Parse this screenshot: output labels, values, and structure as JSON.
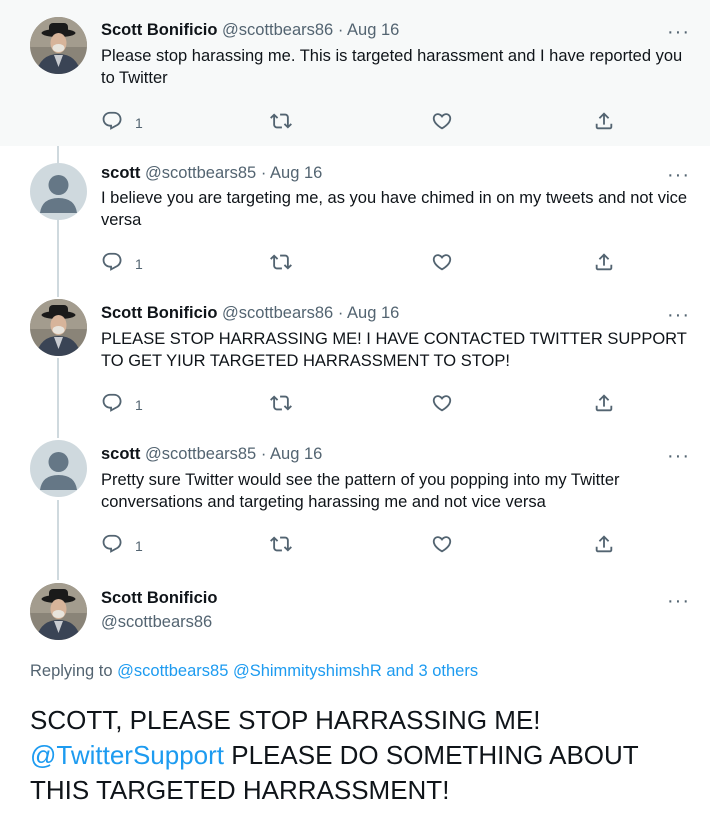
{
  "tweets": [
    {
      "name": "Scott Bonificio",
      "handle": "@scottbears86",
      "sep": "·",
      "date": "Aug 16",
      "text": "Please stop harassing me. This is targeted harassment and I have reported you to Twitter",
      "reply_count": "1",
      "avatar": "photo"
    },
    {
      "name": "scott",
      "handle": "@scottbears85",
      "sep": "·",
      "date": "Aug 16",
      "text": "I believe you are targeting me, as you have chimed in on my tweets and not vice versa",
      "reply_count": "1",
      "avatar": "default"
    },
    {
      "name": "Scott Bonificio",
      "handle": "@scottbears86",
      "sep": "·",
      "date": "Aug 16",
      "text": "PLEASE STOP HARRASSING ME! I HAVE CONTACTED TWITTER SUPPORT TO GET YIUR TARGETED HARRASSMENT TO STOP!",
      "reply_count": "1",
      "avatar": "photo"
    },
    {
      "name": "scott",
      "handle": "@scottbears85",
      "sep": "·",
      "date": "Aug 16",
      "text": "Pretty sure Twitter would see the pattern of you popping into my Twitter conversations and targeting harassing  me and not vice versa",
      "reply_count": "1",
      "avatar": "default"
    }
  ],
  "focus": {
    "name": "Scott Bonificio",
    "handle": "@scottbears86",
    "replying_prefix": "Replying to",
    "replying_users": "@scottbears85 @ShimmityshimshR",
    "replying_and": "and",
    "replying_others": "3 others",
    "text_part1": "SCOTT, PLEASE STOP HARRASSING ME!",
    "mention": "@TwitterSupport",
    "text_part2": " PLEASE DO SOMETHING ABOUT THIS TARGETED HARRASSMENT!"
  },
  "more_glyph": "···",
  "colors": {
    "link": "#1d9bf0",
    "muted": "#536471",
    "thread_line": "#cfd9de",
    "highlight_bg": "#f7f9f9"
  },
  "icons": [
    "reply-icon",
    "retweet-icon",
    "like-icon",
    "share-icon",
    "more-icon"
  ]
}
